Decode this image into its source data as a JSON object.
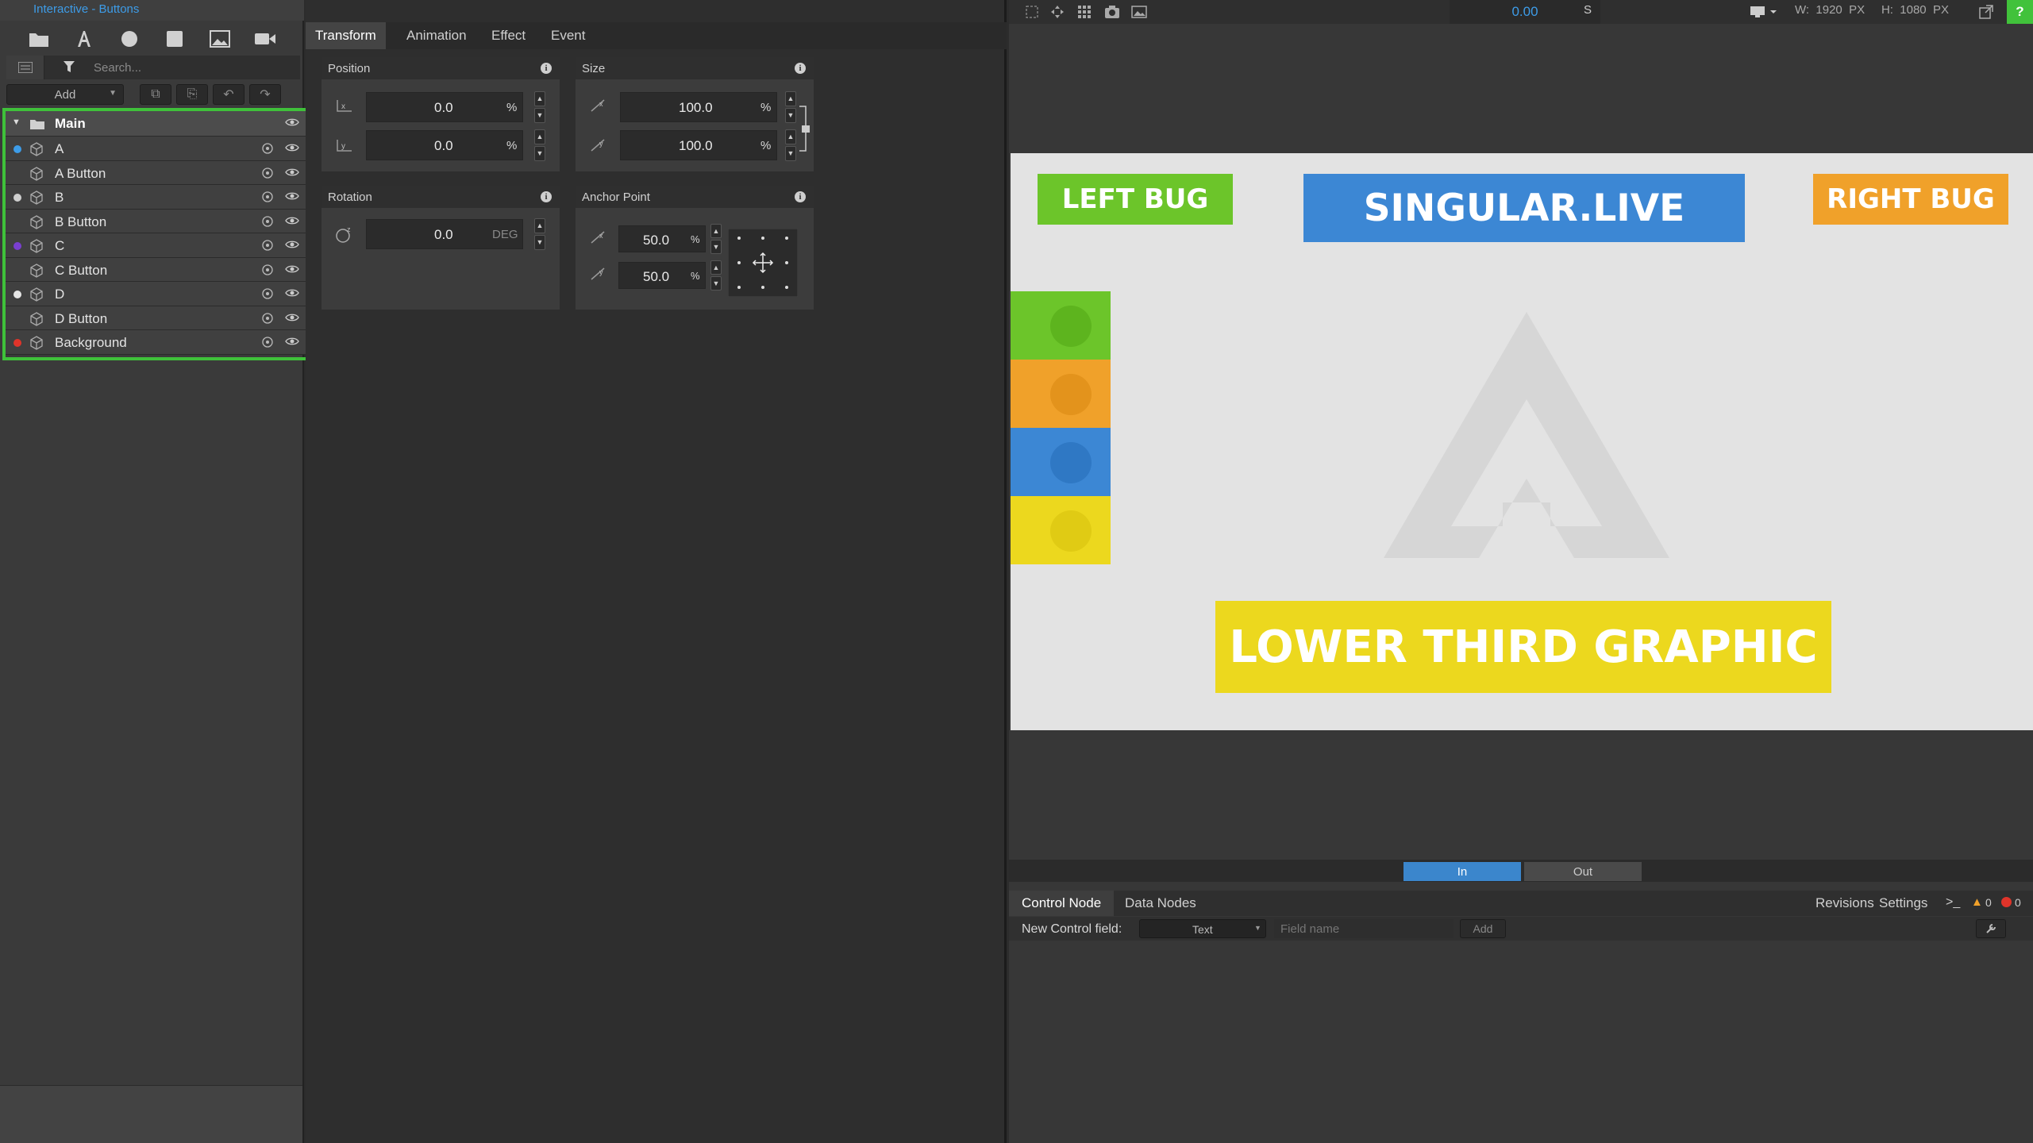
{
  "app": {
    "title": "Interactive - Buttons"
  },
  "search": {
    "placeholder": "Search..."
  },
  "layers": {
    "add_label": "Add",
    "items": [
      {
        "label": "Main",
        "dot": "",
        "main": true
      },
      {
        "label": "A",
        "dot": "#3d9ce8"
      },
      {
        "label": "A Button",
        "dot": ""
      },
      {
        "label": "B",
        "dot": "#cfcfcf"
      },
      {
        "label": "B Button",
        "dot": ""
      },
      {
        "label": "C",
        "dot": "#7a3fd0"
      },
      {
        "label": "C Button",
        "dot": ""
      },
      {
        "label": "D",
        "dot": "#e6e6e6"
      },
      {
        "label": "D Button",
        "dot": ""
      },
      {
        "label": "Background",
        "dot": "#e0342a"
      }
    ]
  },
  "props": {
    "tabs": [
      "Transform",
      "Animation",
      "Effect",
      "Event"
    ],
    "position": {
      "title": "Position",
      "x": "0.0",
      "y": "0.0",
      "unit": "%"
    },
    "size": {
      "title": "Size",
      "w": "100.0",
      "h": "100.0",
      "unit": "%"
    },
    "rotation": {
      "title": "Rotation",
      "z": "0.0",
      "unit": "DEG"
    },
    "anchor": {
      "title": "Anchor Point",
      "x": "50.0",
      "y": "50.0",
      "unit": "%"
    }
  },
  "viewer": {
    "time": "0.00",
    "time_unit": "S",
    "dims": "W:  1920  PX     H:  1080  PX",
    "help": "?"
  },
  "stage": {
    "left_bug": "LEFT BUG",
    "title": "SINGULAR.LIVE",
    "right_bug": "RIGHT BUG",
    "lower_third": "LOWER THIRD GRAPHIC"
  },
  "playback": {
    "in_label": "In",
    "out_label": "Out"
  },
  "control": {
    "tabs": [
      "Control Node",
      "Data Nodes"
    ],
    "revisions": "Revisions",
    "settings": "Settings",
    "warn_count": "0",
    "error_count": "0",
    "new_field_label": "New Control field:",
    "type_value": "Text",
    "field_name_placeholder": "Field name",
    "add_label": "Add"
  },
  "colors": {
    "accent": "#3d9ce8",
    "highlight": "#3fc13a",
    "green": "#6cc52a",
    "orange": "#f0a12a",
    "blue": "#3c87d4",
    "yellow": "#ecd81e"
  }
}
